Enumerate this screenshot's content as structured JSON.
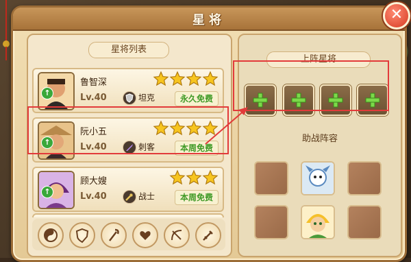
{
  "window": {
    "title": "星将"
  },
  "left_panel": {
    "heading": "星将列表"
  },
  "heroes": [
    {
      "name": "鲁智深",
      "level": "Lv.40",
      "stars": 4,
      "role": "坦克",
      "role_icon": "shield-icon",
      "tag": "永久免费"
    },
    {
      "name": "阮小五",
      "level": "Lv.40",
      "stars": 4,
      "role": "刺客",
      "role_icon": "dagger-icon",
      "tag": "本周免费"
    },
    {
      "name": "顾大嫂",
      "level": "Lv.40",
      "stars": 3,
      "role": "战士",
      "role_icon": "sword-icon",
      "tag": "本周免费"
    }
  ],
  "filters": [
    "yin-yang-icon",
    "shield-icon",
    "staff-icon",
    "heart-icon",
    "bow-icon",
    "sword-icon"
  ],
  "right_panel": {
    "lineup_heading": "上阵星将",
    "lineup_slots": 4,
    "support_heading": "助战阵容",
    "support_grid": [
      "empty",
      "monster-portrait",
      "empty",
      "empty",
      "hero-portrait",
      "empty"
    ]
  },
  "colors": {
    "accent_red": "#e23a3a",
    "tag_green": "#3f9a26",
    "star_gold": "#f7c51f"
  }
}
